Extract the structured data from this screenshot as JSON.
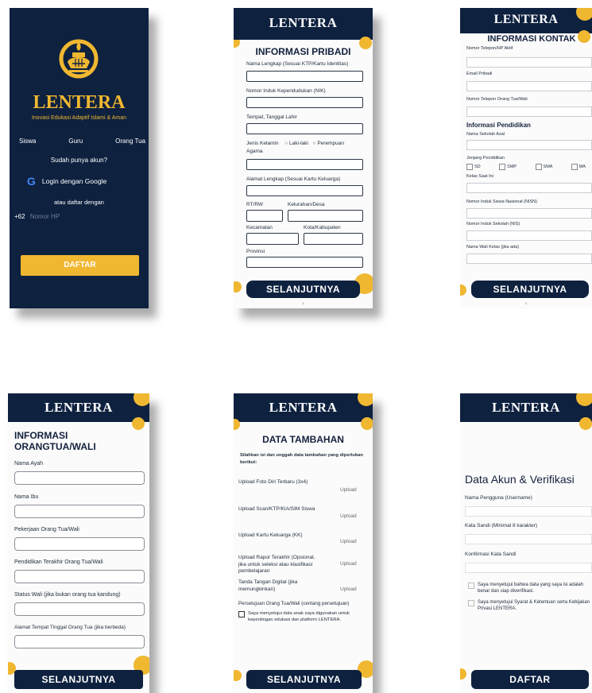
{
  "screen1": {
    "brand": "LENTERA",
    "tagline": "Inovasi Edukasi Adaptif Islami & Aman",
    "roles": [
      "Siswa",
      "Guru",
      "Orang Tua"
    ],
    "have_account": "Sudah punya akun?",
    "google_login": "Login dengan Google",
    "or_register": "atau daftar dengan",
    "country_code": "+62",
    "phone_placeholder": "Nomor HP",
    "register_button": "DAFTAR",
    "colors": {
      "navy": "#0e213f",
      "gold": "#f0b731"
    }
  },
  "screen2": {
    "header": "LENTERA",
    "title": "INFORMASI PRIBADI",
    "full_name": "Nama Lengkap (Sesuai KTP/Kartu Identitas)",
    "nik": "Nomor Induk Kependudukan (NIK)",
    "birth": "Tempat, Tanggal Lahir",
    "gender": "Jenis Kelamin",
    "gender_male": "Laki-laki",
    "gender_female": "Perempuan",
    "religion": "Agama",
    "address": "Alamat Lengkap (Sesuai Kartu Keluarga)",
    "rt_rw": "RT/RW",
    "kelurahan": "Kelurahan/Desa",
    "kecamatan": "Kecamatan",
    "kota": "Kota/Kabupaten",
    "provinsi": "Provinsi",
    "next_button": "SELANJUTNYA",
    "page": "1"
  },
  "screen3": {
    "header": "LENTERA",
    "title": "INFORMASI KONTAK",
    "phone": "Nomor Telepon/HP Aktif",
    "email": "Email Pribadi",
    "parent_phone": "Nomor Telepon Orang Tua/Wali",
    "edu_title": "Informasi Pendidikan",
    "school": "Nama Sekolah Asal",
    "level": "Jenjang Pendidikan",
    "levels": [
      "SD",
      "SMP",
      "SMA",
      "MA"
    ],
    "class": "Kelas Saat Ini",
    "nisn": "Nomor Induk Siswa Nasional (NISN)",
    "nis": "Nomor Induk Sekolah (NIS)",
    "homeroom": "Nama Wali Kelas (jika ada)",
    "next_button": "SELANJUTNYA",
    "page": "1"
  },
  "screen4": {
    "header": "LENTERA",
    "title": "INFORMASI ORANGTUA/WALI",
    "father": "Nama Ayah",
    "mother": "Nama Ibu",
    "job": "Pekerjaan Orang Tua/Wali",
    "education": "Pendidikan Terakhir Orang Tua/Wali",
    "guardian_status": "Status Wali (jika  bukan orang tua kandung)",
    "parent_address": "Alamat Tempat Tinggal Orang Tua (jika berbeda)",
    "next_button": "SELANJUTNYA"
  },
  "screen5": {
    "header": "LENTERA",
    "title": "DATA TAMBAHAN",
    "intro": "Silahkan isi dan unggah data tambahan yang diperlukan berikut:",
    "uploads": [
      {
        "label": "Upload Foto Diri Terbaru (3x4)",
        "action": "Upload"
      },
      {
        "label": "Upload Scan/KTP/KIA/SIM Siswa",
        "action": "Upload"
      },
      {
        "label": "Upload Kartu Keluarga (KK)",
        "action": "Upload"
      },
      {
        "label": "Upload Rapor Terakhir (Opsional, jika untuk seleksi atau klasifikasi pembelajaran",
        "action": "Upload"
      },
      {
        "label": "Tanda Tangan Digital (jika memungkinkan)",
        "action": "Upload"
      }
    ],
    "consent_title": "Persetujuan Orang Tua/Wali (centang persetujuan)",
    "consent_text": "Saya menyetujui data anak saya digunakan untuk kepentingan edukasi dan platform LENTERA.",
    "next_button": "SELANJUTNYA"
  },
  "screen6": {
    "header": "LENTERA",
    "title": "Data Akun & Verifikasi",
    "username": "Nama Pengguna (Username)",
    "password": "Kata Sandi (Minimal 8 karakter)",
    "confirm": "Konfirmasi Kata Sandi",
    "agree1": "Saya menyetujui bahwa data yang saya isi adalah benar dan siap diverifikasi.",
    "agree2": "Saya menyetujui Syarat & Ketentuan serta Kebijakan Privasi LENTERA.",
    "register_button": "DAFTAR"
  }
}
